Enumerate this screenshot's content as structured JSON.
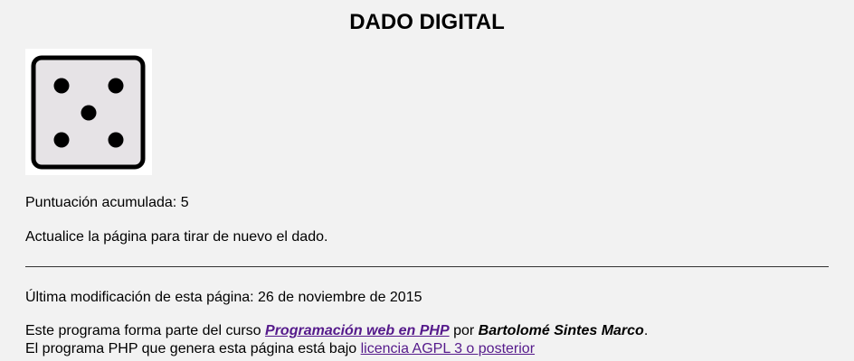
{
  "page": {
    "title": "DADO DIGITAL"
  },
  "dice": {
    "value": 5,
    "icon": "dice-five-icon"
  },
  "score": {
    "label": "Puntuación acumulada:",
    "value": "5"
  },
  "instructions": "Actualice la página para tirar de nuevo el dado.",
  "footer": {
    "modified_label": "Última modificación de esta página:",
    "modified_date": "26 de noviembre de 2015",
    "course_prefix": "Este programa forma parte del curso",
    "course_link": "Programación web en PHP",
    "by": "por",
    "author": "Bartolomé Sintes Marco",
    "period": ".",
    "license_prefix": "El programa PHP que genera esta página está bajo",
    "license_link": "licencia AGPL 3 o posterior"
  }
}
